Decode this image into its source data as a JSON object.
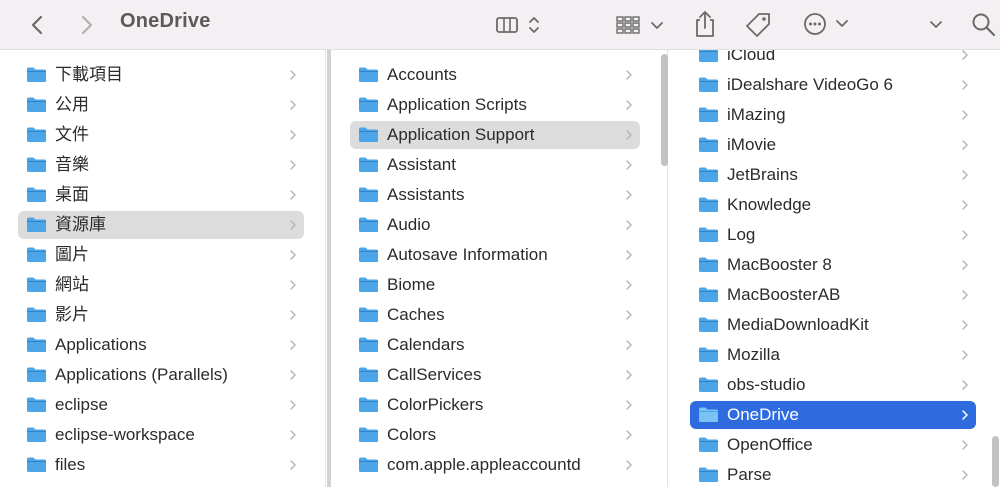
{
  "window": {
    "title": "OneDrive"
  },
  "toolbar": {
    "back_icon": "chevron-left-icon",
    "forward_icon": "chevron-right-icon",
    "view_icon": "column-view-icon",
    "group_icon": "grid-group-icon",
    "share_icon": "share-icon",
    "tag_icon": "tag-icon",
    "more_icon": "ellipsis-circle-icon",
    "search_icon": "search-icon"
  },
  "colors": {
    "folder": "#4ba5e6",
    "folder_dark": "#2d84c9",
    "selection_active": "#2d6bdf",
    "selection_inactive": "#dcdcdc"
  },
  "column1": {
    "items": [
      {
        "label": "下載項目",
        "icon": "downloads-folder-icon"
      },
      {
        "label": "公用",
        "icon": "public-folder-icon"
      },
      {
        "label": "文件",
        "icon": "documents-folder-icon"
      },
      {
        "label": "音樂",
        "icon": "music-folder-icon"
      },
      {
        "label": "桌面",
        "icon": "desktop-folder-icon"
      },
      {
        "label": "資源庫",
        "icon": "library-folder-icon",
        "selected": true
      },
      {
        "label": "圖片",
        "icon": "pictures-folder-icon"
      },
      {
        "label": "網站",
        "icon": "sites-folder-icon"
      },
      {
        "label": "影片",
        "icon": "movies-folder-icon"
      },
      {
        "label": "Applications",
        "icon": "applications-folder-icon"
      },
      {
        "label": "Applications (Parallels)",
        "icon": "applications-folder-icon"
      },
      {
        "label": "eclipse",
        "icon": "folder-icon"
      },
      {
        "label": "eclipse-workspace",
        "icon": "folder-icon"
      },
      {
        "label": "files",
        "icon": "folder-icon"
      }
    ]
  },
  "column2": {
    "items": [
      {
        "label": "Accounts"
      },
      {
        "label": "Application Scripts"
      },
      {
        "label": "Application Support",
        "selected": true
      },
      {
        "label": "Assistant"
      },
      {
        "label": "Assistants"
      },
      {
        "label": "Audio"
      },
      {
        "label": "Autosave Information"
      },
      {
        "label": "Biome"
      },
      {
        "label": "Caches"
      },
      {
        "label": "Calendars"
      },
      {
        "label": "CallServices"
      },
      {
        "label": "ColorPickers"
      },
      {
        "label": "Colors"
      },
      {
        "label": "com.apple.appleaccountd"
      }
    ]
  },
  "column3": {
    "items": [
      {
        "label": "iCloud"
      },
      {
        "label": "iDealshare VideoGo 6"
      },
      {
        "label": "iMazing"
      },
      {
        "label": "iMovie"
      },
      {
        "label": "JetBrains"
      },
      {
        "label": "Knowledge"
      },
      {
        "label": "Log"
      },
      {
        "label": "MacBooster 8"
      },
      {
        "label": "MacBoosterAB"
      },
      {
        "label": "MediaDownloadKit"
      },
      {
        "label": "Mozilla"
      },
      {
        "label": "obs-studio"
      },
      {
        "label": "OneDrive",
        "selected": true
      },
      {
        "label": "OpenOffice"
      },
      {
        "label": "Parse"
      }
    ]
  }
}
